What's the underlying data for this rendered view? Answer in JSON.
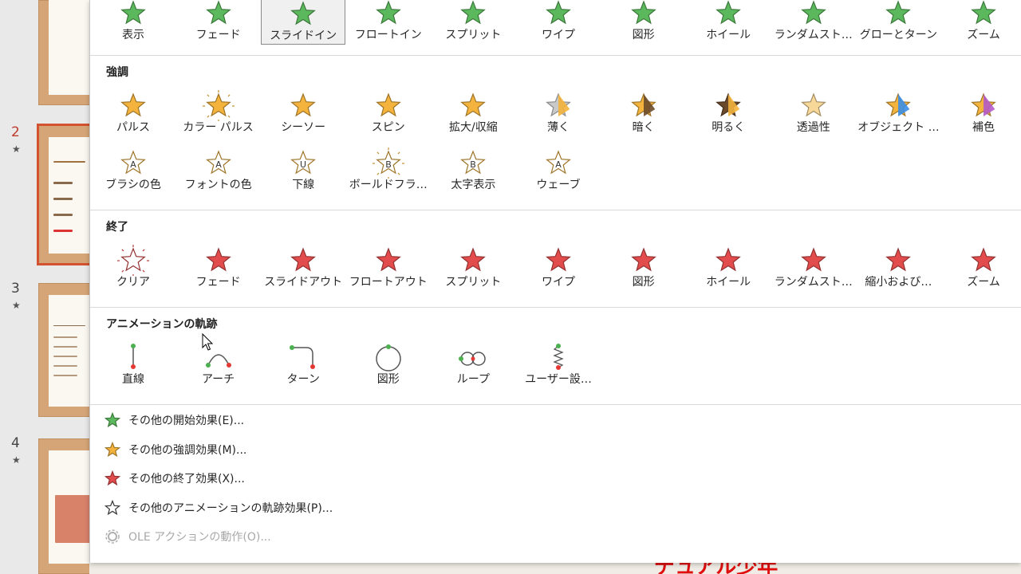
{
  "thumbnails": [
    {
      "num": "",
      "star": ""
    },
    {
      "num": "2",
      "star": "★"
    },
    {
      "num": "3",
      "star": "★"
    },
    {
      "num": "4",
      "star": "★"
    }
  ],
  "colors": {
    "entrance": "#5cb85c",
    "emphasis": "#f3b33d",
    "exit": "#e24c4c",
    "selected_thumb": "#d35230"
  },
  "entrance": {
    "items": [
      {
        "label": "表示",
        "icon": "entrance-appear-icon"
      },
      {
        "label": "フェード",
        "icon": "entrance-fade-icon"
      },
      {
        "label": "スライドイン",
        "icon": "entrance-fly-in-icon",
        "selected": true
      },
      {
        "label": "フロートイン",
        "icon": "entrance-float-in-icon"
      },
      {
        "label": "スプリット",
        "icon": "entrance-split-icon"
      },
      {
        "label": "ワイプ",
        "icon": "entrance-wipe-icon"
      },
      {
        "label": "図形",
        "icon": "entrance-shape-icon"
      },
      {
        "label": "ホイール",
        "icon": "entrance-wheel-icon"
      },
      {
        "label": "ランダムスト…",
        "icon": "entrance-random-bars-icon"
      },
      {
        "label": "グローとターン",
        "icon": "entrance-grow-turn-icon"
      },
      {
        "label": "ズーム",
        "icon": "entrance-zoom-icon"
      }
    ]
  },
  "emphasis": {
    "title": "強調",
    "row1": [
      {
        "label": "パルス",
        "icon": "emphasis-pulse-icon"
      },
      {
        "label": "カラー パルス",
        "icon": "emphasis-color-pulse-icon"
      },
      {
        "label": "シーソー",
        "icon": "emphasis-teeter-icon"
      },
      {
        "label": "スピン",
        "icon": "emphasis-spin-icon"
      },
      {
        "label": "拡大/収縮",
        "icon": "emphasis-grow-shrink-icon"
      },
      {
        "label": "薄く",
        "icon": "emphasis-desaturate-icon"
      },
      {
        "label": "暗く",
        "icon": "emphasis-darken-icon"
      },
      {
        "label": "明るく",
        "icon": "emphasis-lighten-icon"
      },
      {
        "label": "透過性",
        "icon": "emphasis-transparency-icon"
      },
      {
        "label": "オブジェクト …",
        "icon": "emphasis-object-color-icon"
      },
      {
        "label": "補色",
        "icon": "emphasis-complementary-color-icon"
      }
    ],
    "row2": [
      {
        "label": "ブラシの色",
        "icon": "emphasis-brush-color-icon",
        "glyph": "A"
      },
      {
        "label": "フォントの色",
        "icon": "emphasis-font-color-icon",
        "glyph": "A"
      },
      {
        "label": "下線",
        "icon": "emphasis-underline-icon",
        "glyph": "U"
      },
      {
        "label": "ボールドフラ…",
        "icon": "emphasis-bold-flash-icon",
        "glyph": "B"
      },
      {
        "label": "太字表示",
        "icon": "emphasis-bold-reveal-icon",
        "glyph": "B"
      },
      {
        "label": "ウェーブ",
        "icon": "emphasis-wave-icon",
        "glyph": "A"
      }
    ]
  },
  "exit": {
    "title": "終了",
    "items": [
      {
        "label": "クリア",
        "icon": "exit-disappear-icon"
      },
      {
        "label": "フェード",
        "icon": "exit-fade-icon"
      },
      {
        "label": "スライドアウト",
        "icon": "exit-fly-out-icon"
      },
      {
        "label": "フロートアウト",
        "icon": "exit-float-out-icon"
      },
      {
        "label": "スプリット",
        "icon": "exit-split-icon"
      },
      {
        "label": "ワイプ",
        "icon": "exit-wipe-icon"
      },
      {
        "label": "図形",
        "icon": "exit-shape-icon"
      },
      {
        "label": "ホイール",
        "icon": "exit-wheel-icon"
      },
      {
        "label": "ランダムスト…",
        "icon": "exit-random-bars-icon"
      },
      {
        "label": "縮小および…",
        "icon": "exit-shrink-turn-icon"
      },
      {
        "label": "ズーム",
        "icon": "exit-zoom-icon"
      }
    ]
  },
  "motion": {
    "title": "アニメーションの軌跡",
    "items": [
      {
        "label": "直線",
        "icon": "path-lines-icon"
      },
      {
        "label": "アーチ",
        "icon": "path-arcs-icon"
      },
      {
        "label": "ターン",
        "icon": "path-turns-icon"
      },
      {
        "label": "図形",
        "icon": "path-shapes-icon"
      },
      {
        "label": "ループ",
        "icon": "path-loops-icon"
      },
      {
        "label": "ユーザー設…",
        "icon": "path-custom-icon"
      }
    ]
  },
  "menu": [
    {
      "label": "その他の開始効果(E)...",
      "icon": "more-entrance-icon",
      "enabled": true
    },
    {
      "label": "その他の強調効果(M)...",
      "icon": "more-emphasis-icon",
      "enabled": true
    },
    {
      "label": "その他の終了効果(X)...",
      "icon": "more-exit-icon",
      "enabled": true
    },
    {
      "label": "その他のアニメーションの軌跡効果(P)...",
      "icon": "more-motion-path-icon",
      "enabled": true
    },
    {
      "label": "OLE アクションの動作(O)...",
      "icon": "ole-action-gear-icon",
      "enabled": false
    }
  ],
  "background": {
    "slide_text": "デュアル少年"
  }
}
